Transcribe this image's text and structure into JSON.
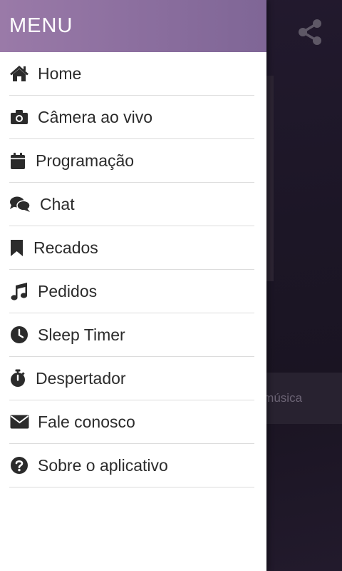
{
  "drawer": {
    "title": "MENU",
    "items": [
      {
        "label": "Home",
        "icon": "home-icon"
      },
      {
        "label": "Câmera ao vivo",
        "icon": "camera-icon"
      },
      {
        "label": "Programação",
        "icon": "calendar-icon"
      },
      {
        "label": "Chat",
        "icon": "chat-icon"
      },
      {
        "label": "Recados",
        "icon": "bookmark-icon"
      },
      {
        "label": "Pedidos",
        "icon": "music-icon"
      },
      {
        "label": "Sleep Timer",
        "icon": "clock-icon"
      },
      {
        "label": "Despertador",
        "icon": "stopwatch-icon"
      },
      {
        "label": "Fale conosco",
        "icon": "envelope-icon"
      },
      {
        "label": "Sobre o aplicativo",
        "icon": "question-icon"
      }
    ]
  },
  "background": {
    "share_icon": "share-icon",
    "partial_text": "a música"
  },
  "colors": {
    "header_start": "#9a7aa8",
    "header_end": "#7f6696",
    "icon": "#2b2b2b",
    "background": "#1c1626"
  }
}
